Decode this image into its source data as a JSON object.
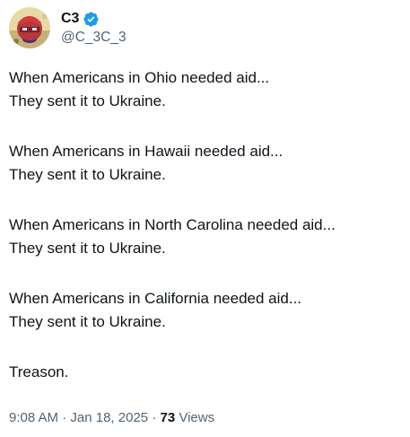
{
  "author": {
    "name": "C3",
    "handle": "@C_3C_3",
    "verified_icon": "verified-badge-icon",
    "avatar_icon": "avatar-image"
  },
  "tweet": {
    "paragraphs": [
      [
        "When Americans in Ohio needed aid...",
        "They sent it to Ukraine."
      ],
      [
        "When Americans in Hawaii needed aid...",
        "They sent it to Ukraine."
      ],
      [
        "When Americans in North Carolina needed aid...",
        "They sent it to Ukraine."
      ],
      [
        "When Americans in California needed aid...",
        "They sent it to Ukraine."
      ],
      [
        "Treason."
      ]
    ]
  },
  "meta": {
    "time": "9:08 AM",
    "separator": "·",
    "date": "Jan 18, 2025",
    "views_count": "73",
    "views_label": "Views"
  },
  "colors": {
    "text": "#0f1419",
    "secondary": "#536471",
    "verified": "#1d9bf0"
  }
}
